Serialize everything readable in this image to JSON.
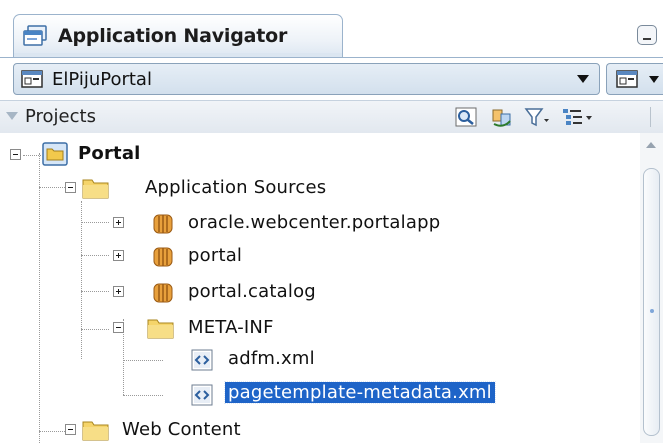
{
  "panel": {
    "title": "Application Navigator"
  },
  "application": {
    "selected": "ElPijuPortal"
  },
  "projects": {
    "label": "Projects"
  },
  "tree": {
    "portal": "Portal",
    "app_sources": "Application Sources",
    "pkg_portalapp": "oracle.webcenter.portalapp",
    "pkg_portal": "portal",
    "pkg_catalog": "portal.catalog",
    "meta_inf": "META-INF",
    "file_adfm": "adfm.xml",
    "file_pagetemplate": "pagetemplate-metadata.xml",
    "web_content": "Web Content"
  },
  "colors": {
    "selection": "#1e64c8",
    "tab_border": "#9bb3cc",
    "folder": "#f2c94c",
    "package": "#d9892b"
  }
}
